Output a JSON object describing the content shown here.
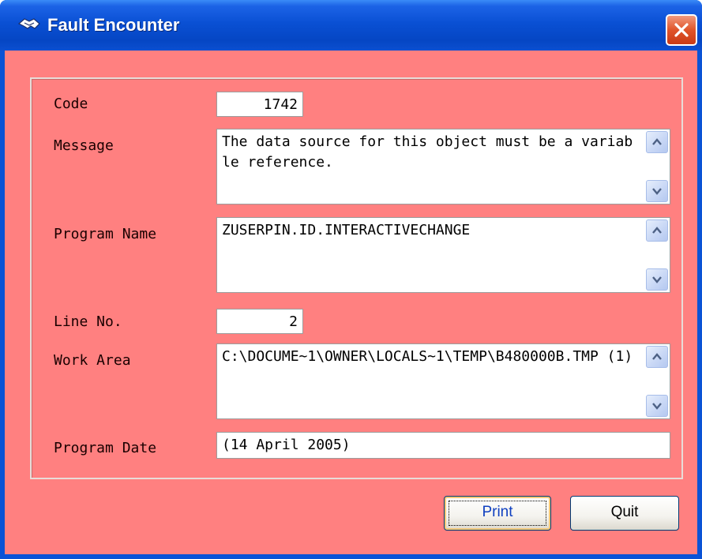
{
  "window": {
    "title": "Fault Encounter",
    "title_icon": "handshake-icon",
    "close_icon": "close-icon"
  },
  "colors": {
    "background": "#ff8080",
    "titlebar": "#0a50d4"
  },
  "fields": {
    "code": {
      "label": "Code",
      "value": "1742"
    },
    "message": {
      "label": "Message",
      "value": "The data source for this object must be a variable reference."
    },
    "program_name": {
      "label": "Program Name",
      "value": "ZUSERPIN.ID.INTERACTIVECHANGE"
    },
    "line_no": {
      "label": "Line No.",
      "value": "2"
    },
    "work_area": {
      "label": "Work Area",
      "value": "C:\\DOCUME~1\\OWNER\\LOCALS~1\\TEMP\\B480000B.TMP (1)"
    },
    "program_date": {
      "label": "Program Date",
      "value": "(14 April 2005)"
    }
  },
  "buttons": {
    "print": "Print",
    "quit": "Quit"
  }
}
